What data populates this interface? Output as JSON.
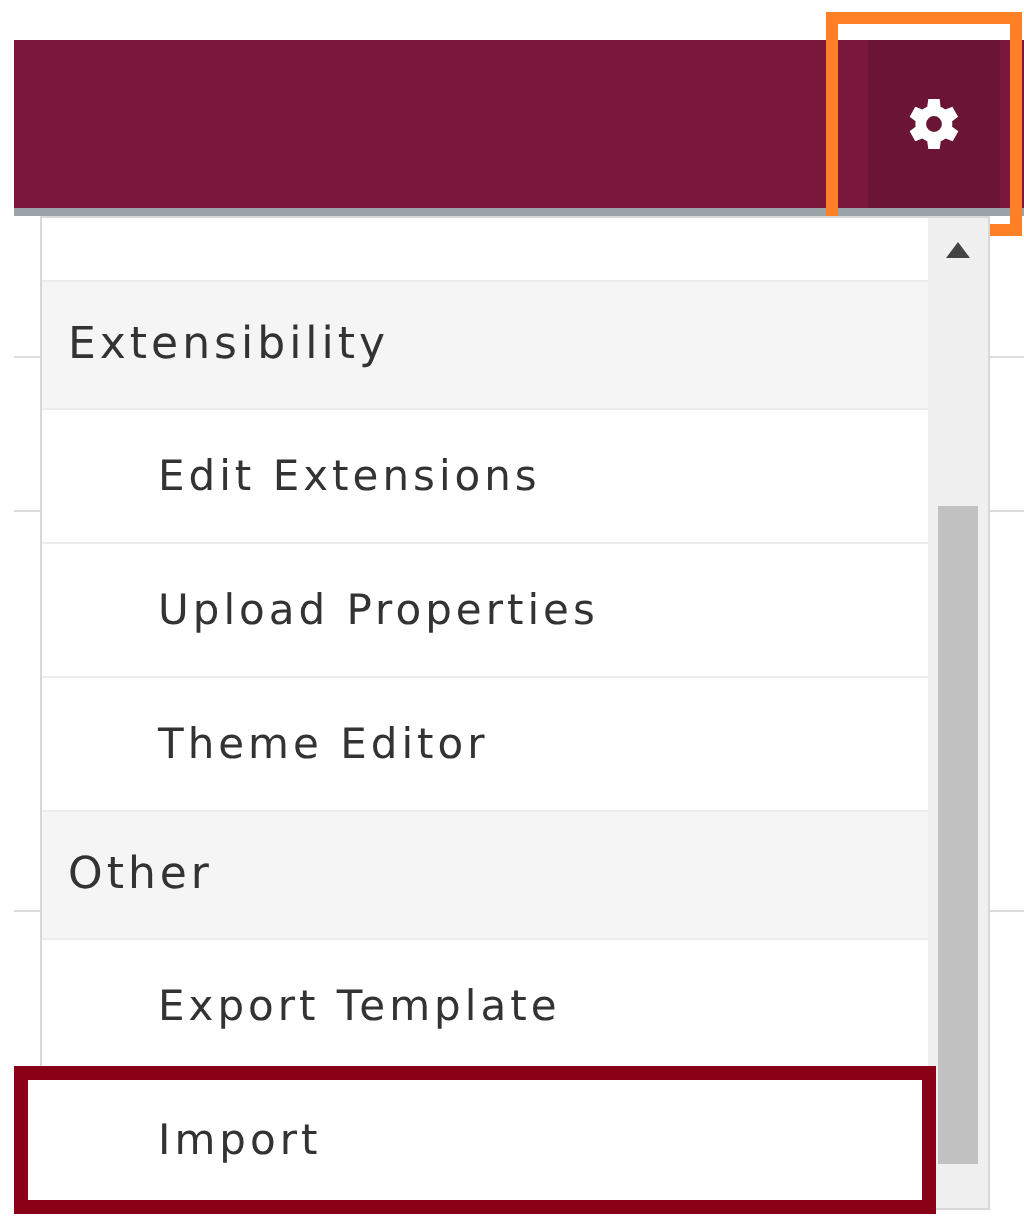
{
  "header": {
    "settings_button": {
      "highlighted": true
    }
  },
  "menu": {
    "sections": [
      {
        "label": "Extensibility",
        "items": [
          {
            "label": "Edit Extensions",
            "highlighted": false
          },
          {
            "label": "Upload Properties",
            "highlighted": false
          },
          {
            "label": "Theme Editor",
            "highlighted": false
          }
        ]
      },
      {
        "label": "Other",
        "items": [
          {
            "label": "Export Template",
            "highlighted": false
          },
          {
            "label": "Import",
            "highlighted": true
          }
        ]
      }
    ]
  }
}
